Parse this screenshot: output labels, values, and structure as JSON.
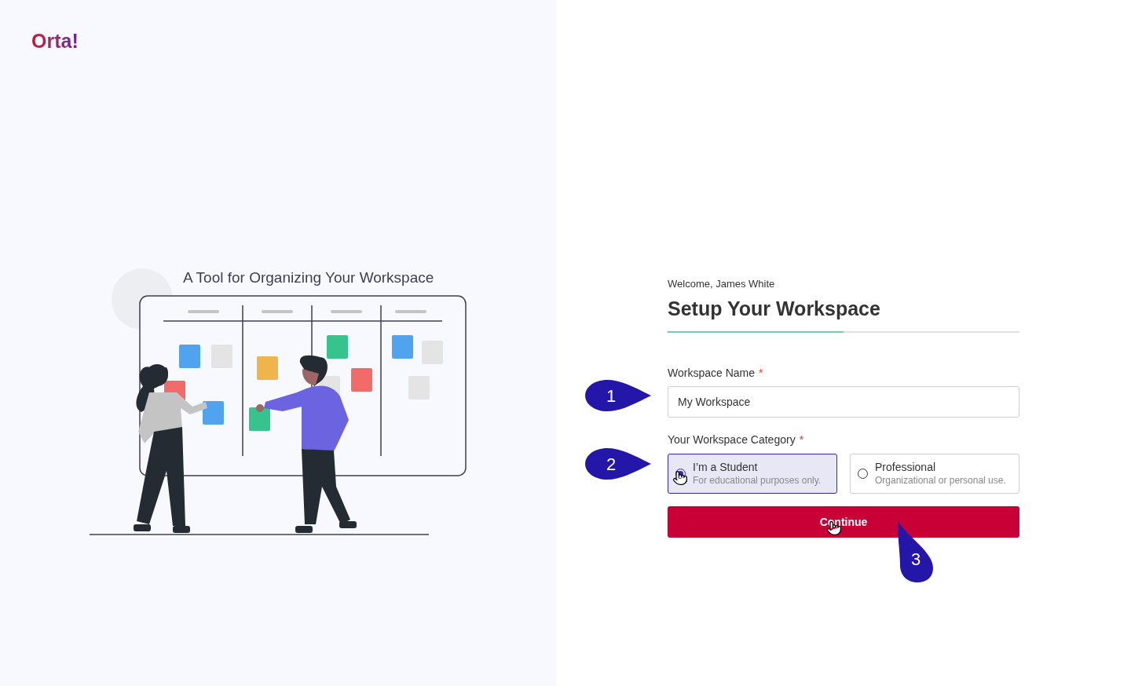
{
  "logo": {
    "text": "Orta!"
  },
  "hero": {
    "headline": "A Tool for Organizing Your Workspace"
  },
  "form": {
    "greeting": "Welcome, James White",
    "title": "Setup Your Workspace",
    "progress": {
      "level": 0.5
    },
    "name_field": {
      "label": "Workspace Name",
      "required_mark": "*",
      "value": "My Workspace"
    },
    "category_field": {
      "label": "Your Workspace Category",
      "required_mark": "*",
      "options": [
        {
          "title": "I’m a Student",
          "description": "For educational purposes only.",
          "selected": true
        },
        {
          "title": "Professional",
          "description": "Organizational or personal use.",
          "selected": false
        }
      ]
    },
    "submit": {
      "label": "Continue"
    }
  },
  "callouts": [
    {
      "number": "1",
      "kind": "point-right"
    },
    {
      "number": "2",
      "kind": "point-right"
    },
    {
      "number": "3",
      "kind": "point-up"
    }
  ]
}
